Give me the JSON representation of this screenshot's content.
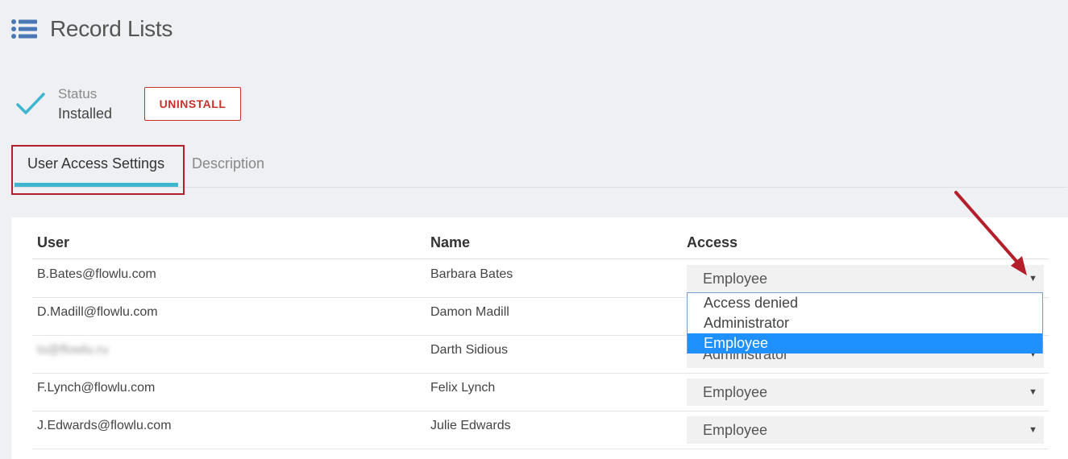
{
  "header": {
    "title": "Record Lists",
    "icon": "list-icon"
  },
  "status": {
    "label": "Status",
    "value": "Installed",
    "icon": "check-icon",
    "color": "#3fb6cf"
  },
  "actions": {
    "uninstall_label": "UNINSTALL"
  },
  "tabs": [
    {
      "label": "User Access Settings",
      "active": true
    },
    {
      "label": "Description",
      "active": false
    }
  ],
  "table": {
    "headers": {
      "user": "User",
      "name": "Name",
      "access": "Access"
    },
    "rows": [
      {
        "user": "B.Bates@flowlu.com",
        "name": "Barbara Bates",
        "access": "Employee"
      },
      {
        "user": "D.Madill@flowlu.com",
        "name": "Damon Madill",
        "access": ""
      },
      {
        "user": "ts@flowlu.ru",
        "name": "Darth Sidious",
        "access": "Administrator"
      },
      {
        "user": "F.Lynch@flowlu.com",
        "name": "Felix Lynch",
        "access": "Employee"
      },
      {
        "user": "J.Edwards@flowlu.com",
        "name": "Julie Edwards",
        "access": "Employee"
      }
    ]
  },
  "dropdown": {
    "options": [
      "Access denied",
      "Administrator",
      "Employee"
    ],
    "selected": "Employee"
  },
  "colors": {
    "accent": "#3fb6cf",
    "danger": "#c9302c",
    "highlight": "#1e90ff",
    "annotation": "#b3202b"
  }
}
